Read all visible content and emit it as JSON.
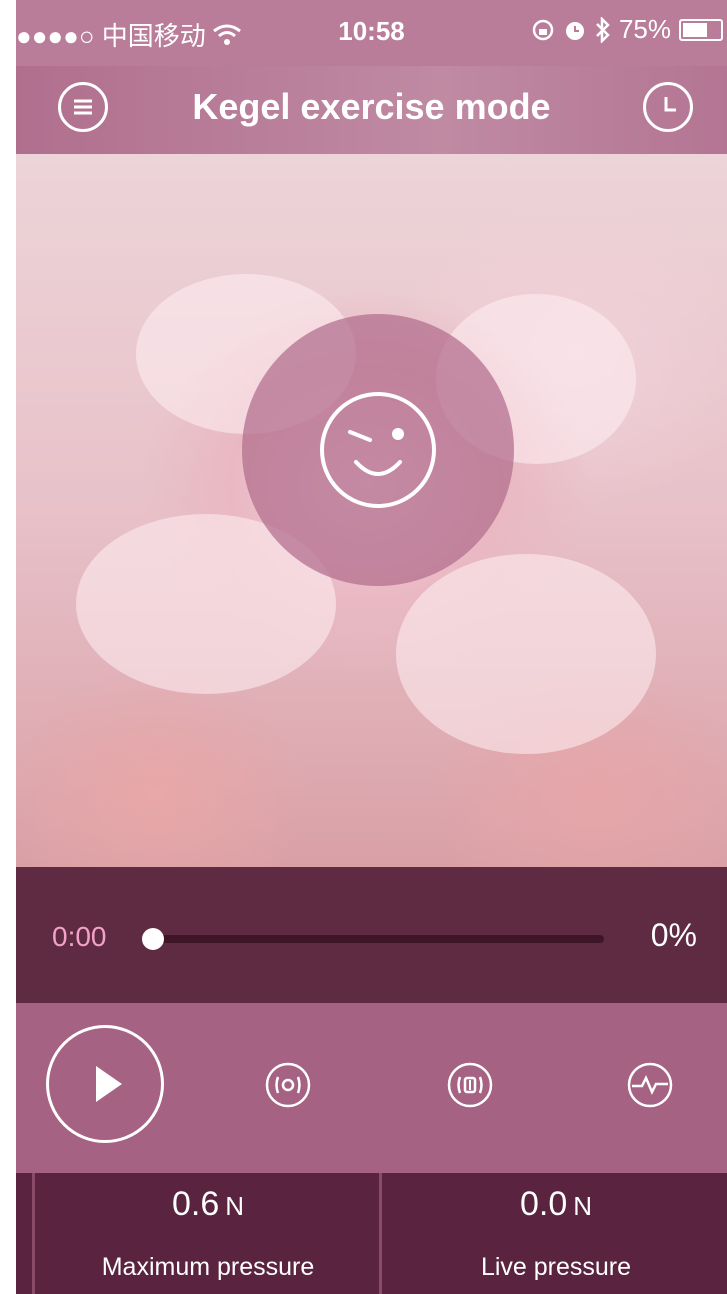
{
  "status_bar": {
    "carrier": "●●●●○ 中国移动",
    "time": "10:58",
    "battery_text": "75%",
    "battery_level": 0.75
  },
  "header": {
    "title": "Kegel exercise mode"
  },
  "progress": {
    "time": "0:00",
    "percent": "0%",
    "value": 0
  },
  "pressure": {
    "max": {
      "value": "0.6",
      "unit": "N",
      "label": "Maximum pressure"
    },
    "live": {
      "value": "0.0",
      "unit": "N",
      "label": "Live pressure"
    }
  },
  "icons": {
    "menu": "menu-icon",
    "history": "clock-icon",
    "face": "wink-face-icon",
    "play": "play-icon",
    "mode1": "vibration-mode-icon",
    "mode2": "pulse-mode-icon",
    "mode3": "heartbeat-icon"
  },
  "colors": {
    "header": "#b97d9a",
    "controls": "#a66283",
    "progress_panel": "#5e2b43",
    "pressure_panel": "#5a2440",
    "time_accent": "#f2a2c6"
  }
}
